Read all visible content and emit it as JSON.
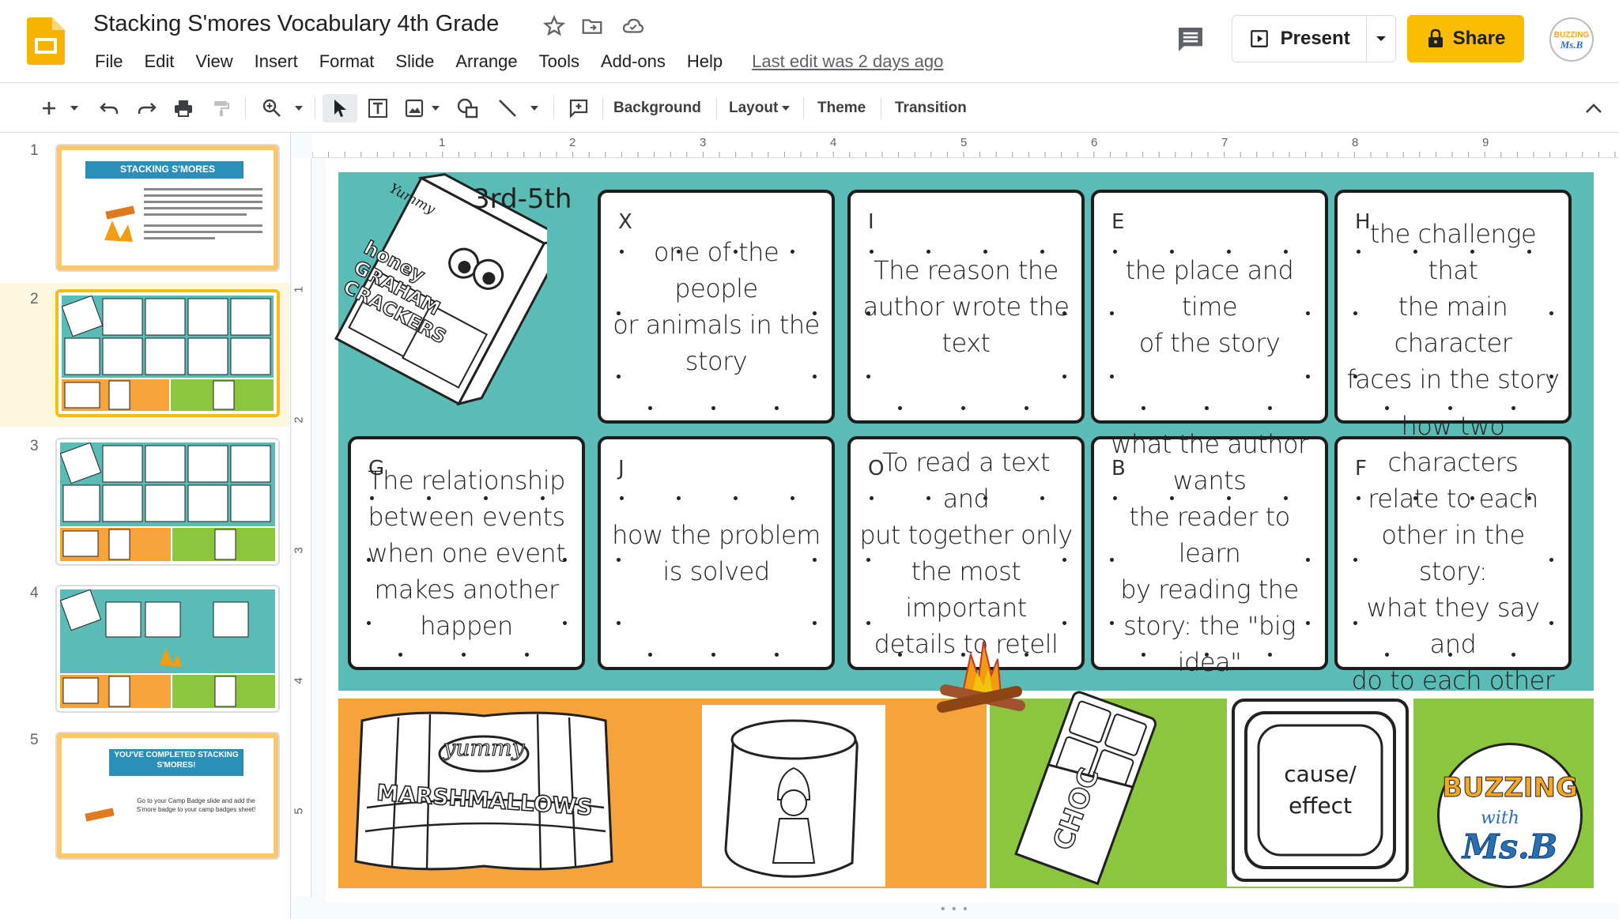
{
  "header": {
    "title": "Stacking S'mores Vocabulary 4th Grade",
    "menu": [
      "File",
      "Edit",
      "View",
      "Insert",
      "Format",
      "Slide",
      "Arrange",
      "Tools",
      "Add-ons",
      "Help"
    ],
    "last_edit": "Last edit was 2 days ago",
    "present_label": "Present",
    "share_label": "Share"
  },
  "toolbar": {
    "background_label": "Background",
    "layout_label": "Layout",
    "theme_label": "Theme",
    "transition_label": "Transition"
  },
  "filmstrip": {
    "slides": [
      {
        "number": "1",
        "title": "STACKING S'MORES"
      },
      {
        "number": "2"
      },
      {
        "number": "3"
      },
      {
        "number": "4"
      },
      {
        "number": "5",
        "title": "YOU'VE COMPLETED STACKING S'MORES!",
        "text": "Go to your Camp Badge slide and add the S'more badge to your camp badges sheet!"
      }
    ],
    "selected": "2"
  },
  "ruler": {
    "top": [
      "1",
      "2",
      "3",
      "4",
      "5",
      "6",
      "7",
      "8",
      "9"
    ],
    "left": [
      "1",
      "2",
      "3",
      "4",
      "5"
    ]
  },
  "slide": {
    "grade": "3rd-5th",
    "box_brand": "Yummy",
    "box_title": "honey GRAHAM CRACKERS",
    "cards": [
      {
        "letter": "X",
        "text": "one of the people\nor animals in the\nstory"
      },
      {
        "letter": "I",
        "text": "The reason the\nauthor wrote the\ntext"
      },
      {
        "letter": "E",
        "text": "the place and\ntime\nof the story"
      },
      {
        "letter": "H",
        "text": "the challenge\nthat\nthe main\ncharacter\nfaces in the story"
      },
      {
        "letter": "G",
        "text": "The relationship\nbetween events\nwhen one event\nmakes another\nhappen"
      },
      {
        "letter": "J",
        "text": "how the problem\nis solved"
      },
      {
        "letter": "O",
        "text": "To read a text and\nput together only\nthe most important\ndetails to retell"
      },
      {
        "letter": "B",
        "text": "what the author\nwants\nthe reader to learn\nby reading the\nstory: the \"big idea\""
      },
      {
        "letter": "F",
        "text": "how two characters\nrelate to each\nother in the story:\nwhat they say and\ndo to each other"
      }
    ],
    "marshmallow_bag_top": "yummy",
    "marshmallow_bag_label": "MARSHMALLOWS",
    "chocolate_label": "CHOC",
    "chocolate_tag": "cause/\neffect",
    "badge_line1": "BUZZING",
    "badge_line2": "with",
    "badge_line3": "Ms.B"
  }
}
